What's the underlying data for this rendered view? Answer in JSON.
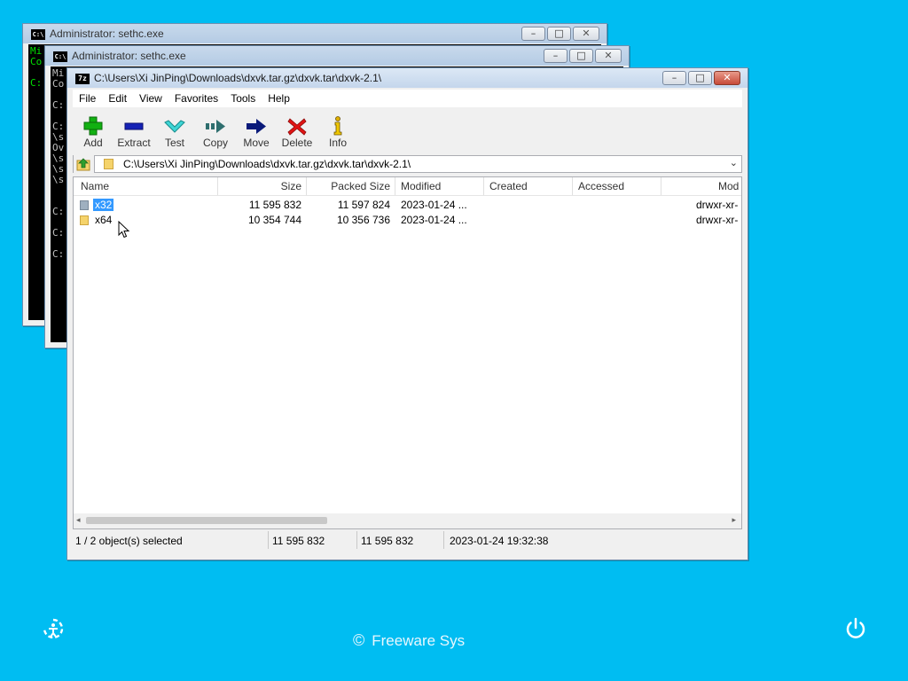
{
  "colors": {
    "desktop": "#00BDF2",
    "selection": "#3399FF",
    "console_green": "#00E000"
  },
  "console_back": {
    "title": "Administrator: sethc.exe",
    "lines": [
      "Mi",
      "Co",
      "",
      "C:"
    ]
  },
  "console_mid": {
    "title": "Administrator: sethc.exe",
    "lines": [
      "Mi",
      "Co",
      "",
      "C:",
      "",
      "C:",
      "\\s",
      "Ov",
      "\\s",
      "\\s",
      "\\s",
      "",
      "",
      "C:",
      "",
      "C:",
      "",
      "C:"
    ]
  },
  "zip_window": {
    "title": "C:\\Users\\Xi JinPing\\Downloads\\dxvk.tar.gz\\dxvk.tar\\dxvk-2.1\\",
    "icon_label": "7z",
    "menu": [
      "File",
      "Edit",
      "View",
      "Favorites",
      "Tools",
      "Help"
    ],
    "toolbar": [
      {
        "label": "Add",
        "icon": "plus-icon"
      },
      {
        "label": "Extract",
        "icon": "minus-icon"
      },
      {
        "label": "Test",
        "icon": "check-icon"
      },
      {
        "label": "Copy",
        "icon": "copy-arrow-icon"
      },
      {
        "label": "Move",
        "icon": "move-arrow-icon"
      },
      {
        "label": "Delete",
        "icon": "delete-x-icon"
      },
      {
        "label": "Info",
        "icon": "info-icon"
      }
    ],
    "address": "C:\\Users\\Xi JinPing\\Downloads\\dxvk.tar.gz\\dxvk.tar\\dxvk-2.1\\",
    "columns": [
      "Name",
      "Size",
      "Packed Size",
      "Modified",
      "Created",
      "Accessed",
      "Mod"
    ],
    "rows": [
      {
        "name": "x32",
        "size": "11 595 832",
        "packed": "11 597 824",
        "modified": "2023-01-24 ...",
        "created": "",
        "accessed": "",
        "mode": "drwxr-xr-",
        "selected": true
      },
      {
        "name": "x64",
        "size": "10 354 744",
        "packed": "10 356 736",
        "modified": "2023-01-24 ...",
        "created": "",
        "accessed": "",
        "mode": "drwxr-xr-",
        "selected": false
      }
    ],
    "status": {
      "selection": "1 / 2 object(s) selected",
      "size": "11 595 832",
      "packed": "11 595 832",
      "modified": "2023-01-24 19:32:38"
    }
  },
  "footer": {
    "copyright_symbol": "©",
    "text": "Freeware Sys"
  }
}
